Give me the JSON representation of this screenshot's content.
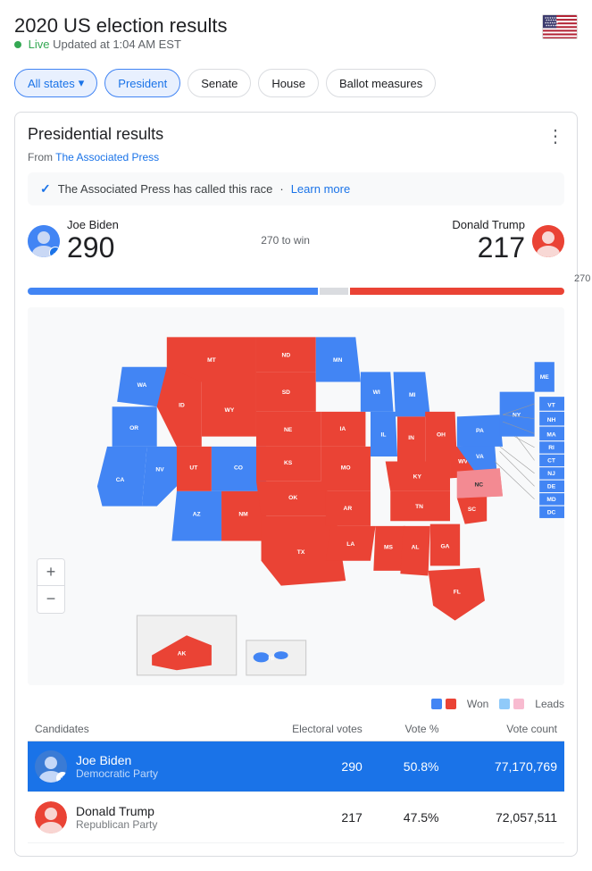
{
  "page": {
    "title": "2020 US election results",
    "live_label": "Live",
    "updated": "Updated at 1:04 AM EST",
    "tabs": [
      {
        "id": "all-states",
        "label": "All states",
        "active": true,
        "dropdown": true
      },
      {
        "id": "president",
        "label": "President",
        "active": true
      },
      {
        "id": "senate",
        "label": "Senate",
        "active": false
      },
      {
        "id": "house",
        "label": "House",
        "active": false
      },
      {
        "id": "ballot-measures",
        "label": "Ballot measures",
        "active": false
      }
    ]
  },
  "section": {
    "title": "Presidential results",
    "source_prefix": "From",
    "source_name": "The Associated Press",
    "ap_notice": "The Associated Press has called this race",
    "learn_more": "Learn more"
  },
  "candidates": {
    "left": {
      "name": "Joe Biden",
      "votes": "290",
      "party": "Democratic Party",
      "color": "#4285f4"
    },
    "right": {
      "name": "Donald Trump",
      "votes": "217",
      "party": "Republican Party",
      "color": "#ea4335"
    },
    "threshold": "270 to win"
  },
  "legend": {
    "won_label": "Won",
    "leads_label": "Leads",
    "biden_color": "#4285f4",
    "trump_color": "#ea4335",
    "leads_biden": "#90caf9",
    "leads_trump": "#f8bbd0"
  },
  "table": {
    "col_candidates": "Candidates",
    "col_electoral": "Electoral votes",
    "col_vote_pct": "Vote %",
    "col_vote_count": "Vote count",
    "rows": [
      {
        "name": "Joe Biden",
        "party": "Democratic Party",
        "electoral": "290",
        "vote_pct": "50.8%",
        "vote_count": "77,170,769",
        "winner": true,
        "color": "biden"
      },
      {
        "name": "Donald Trump",
        "party": "Republican Party",
        "electoral": "217",
        "vote_pct": "47.5%",
        "vote_count": "72,057,511",
        "winner": false,
        "color": "trump"
      }
    ]
  },
  "zoom": {
    "plus": "+",
    "minus": "−"
  }
}
